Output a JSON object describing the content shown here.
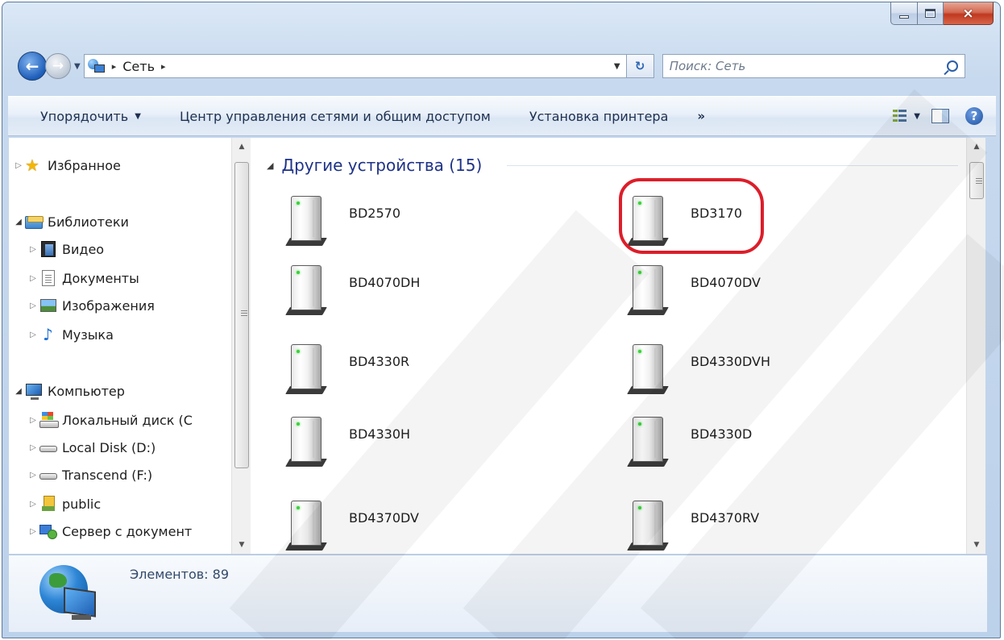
{
  "window": {
    "caption_buttons": {
      "minimize": "minimize-icon",
      "maximize": "maximize-icon",
      "close": "×"
    }
  },
  "address_bar": {
    "location_icon": "network-icon",
    "breadcrumb_sep_1": "▸",
    "location": "Сеть",
    "breadcrumb_sep_2": "▸",
    "dropdown": "▼",
    "refresh_glyph": "↻"
  },
  "search": {
    "placeholder": "Поиск: Сеть"
  },
  "command_bar": {
    "organize": "Упорядочить",
    "organize_arrow": "▼",
    "network_center": "Центр управления сетями и общим доступом",
    "install_printer": "Установка принтера",
    "more": "»",
    "view_arrow": "▼",
    "help_glyph": "?"
  },
  "nav_pane": {
    "favorites": "Избранное",
    "libraries": "Библиотеки",
    "video": "Видео",
    "documents": "Документы",
    "images": "Изображения",
    "music": "Музыка",
    "computer": "Компьютер",
    "local_disk_c": "Локальный диск (С",
    "local_disk_d": "Local Disk (D:)",
    "transcend_f": "Transcend (F:)",
    "public": "public",
    "server": "Сервер с документ"
  },
  "content": {
    "group_title": "Другие устройства (15)",
    "devices": [
      "BD2570",
      "BD3170",
      "BD4070DH",
      "BD4070DV",
      "BD4330R",
      "BD4330DVH",
      "BD4330H",
      "BD4330D",
      "BD4370DV",
      "BD4370RV"
    ]
  },
  "details": {
    "items_count": "Элементов: 89"
  },
  "colors": {
    "highlight": "#dc1e2a",
    "group_title": "#1e3287",
    "accent": "#2a5ea8"
  }
}
